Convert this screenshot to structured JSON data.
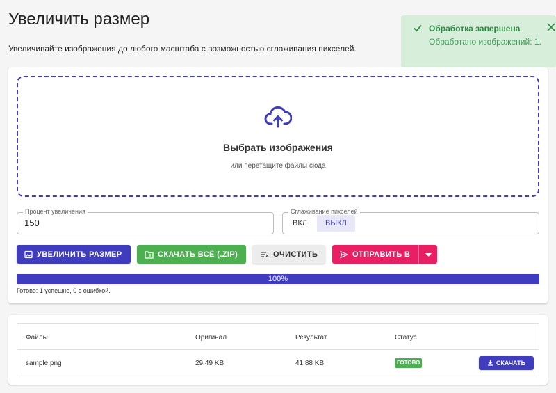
{
  "header": {
    "title": "Увеличить размер",
    "subtitle": "Увеличивайте изображения до любого масштаба с возможностью сглаживания пикселей."
  },
  "toast": {
    "title": "Обработка завершена",
    "message": "Обработано изображений: 1."
  },
  "dropzone": {
    "title": "Выбрать изображения",
    "subtitle": "или перетащите файлы сюда"
  },
  "scale_field": {
    "label": "Процент увеличения",
    "value": "150"
  },
  "smoothing_field": {
    "label": "Сглаживание пикселей",
    "on_label": "ВКЛ",
    "off_label": "ВЫКЛ",
    "selected": "ВЫКЛ"
  },
  "actions": {
    "upscale_label": "УВЕЛИЧИТЬ РАЗМЕР",
    "download_zip_label": "СКАЧАТЬ ВСЁ (.ZIP)",
    "clear_label": "ОЧИСТИТЬ",
    "send_label": "ОТПРАВИТЬ В"
  },
  "progress": {
    "percent": 100,
    "label": "100%",
    "status": "Готово: 1 успешно, 0 с ошибкой."
  },
  "table": {
    "headers": [
      "Файлы",
      "Оригинал",
      "Результат",
      "Статус"
    ],
    "rows": [
      {
        "file": "sample.png",
        "original": "29,49 KB",
        "result": "41,88 KB",
        "status": "ГОТОВО",
        "action": "СКАЧАТЬ"
      }
    ]
  },
  "colors": {
    "primary": "#3f3dbd",
    "success": "#4caf50",
    "accent": "#e91e63",
    "toast_bg": "#d7eedb"
  }
}
